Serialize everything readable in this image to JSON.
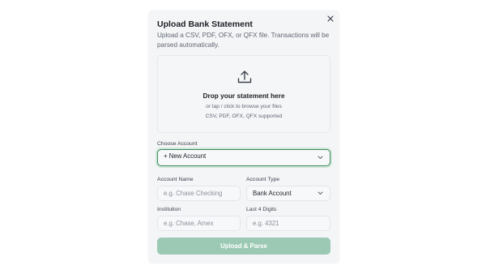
{
  "modal": {
    "title": "Upload Bank Statement",
    "subtitle": "Upload a CSV, PDF, OFX, or QFX file. Transactions will be parsed automatically.",
    "close_icon": "close-icon"
  },
  "dropzone": {
    "icon": "upload-icon",
    "title": "Drop your statement here",
    "hint": "or tap / click to browse your files",
    "formats": "CSV, PDF, OFX, QFX supported"
  },
  "account": {
    "label": "Choose Account",
    "selected": "+ New Account"
  },
  "account_name": {
    "label": "Account Name",
    "placeholder": "e.g. Chase Checking"
  },
  "account_type": {
    "label": "Account Type",
    "selected": "Bank Account"
  },
  "institution": {
    "label": "Institution",
    "placeholder": "e.g. Chase, Amex"
  },
  "last4": {
    "label": "Last 4 Digits",
    "placeholder": "e.g. 4321"
  },
  "submit": {
    "label": "Upload & Parse"
  },
  "colors": {
    "accent": "#3e8a5e",
    "button_disabled": "#9cc9b3",
    "panel": "#f4f5f7"
  }
}
